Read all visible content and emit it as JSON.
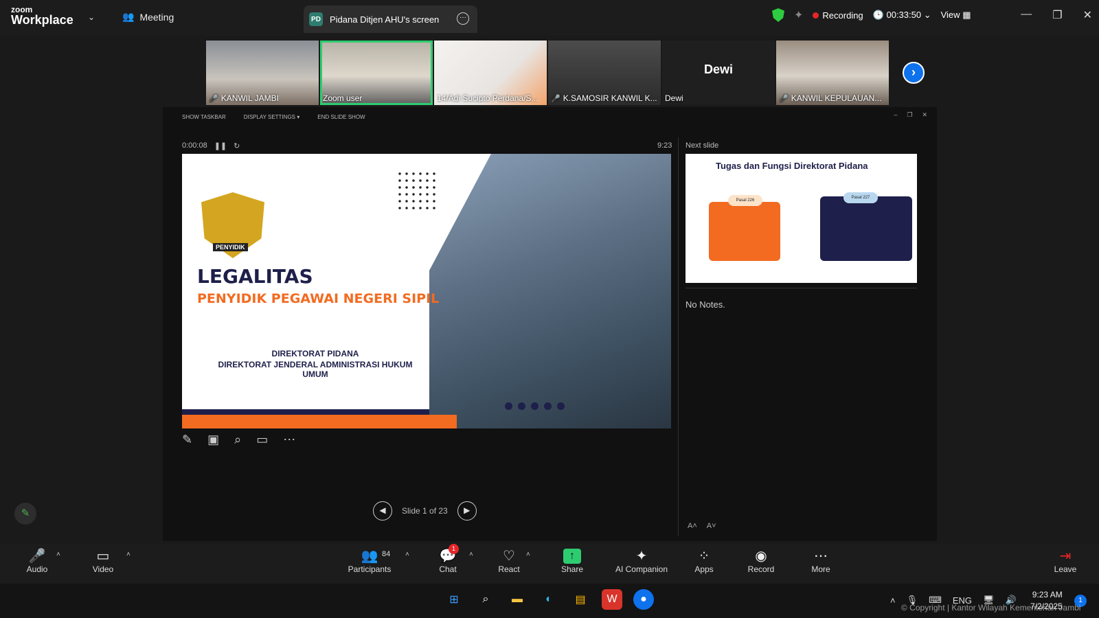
{
  "app": {
    "logo_top": "zoom",
    "logo_bottom": "Workplace",
    "meeting_label": "Meeting"
  },
  "share_tab": {
    "badge": "PD",
    "label": "Pidana Ditjen AHU's screen"
  },
  "status": {
    "recording": "Recording",
    "elapsed": "00:33:50",
    "view": "View"
  },
  "gallery": [
    {
      "name": "KANWIL JAMBI",
      "muted": true
    },
    {
      "name": "Zoom user",
      "muted": false,
      "active": true
    },
    {
      "name": "14/Adi Sucipto Perdana/S...",
      "muted": false
    },
    {
      "name": "K.SAMOSIR KANWIL K...",
      "muted": true
    },
    {
      "name": "Dewi",
      "muted": false,
      "big_label": "Dewi"
    },
    {
      "name": "KANWIL KEPULAUAN...",
      "muted": true
    }
  ],
  "presenter": {
    "show_taskbar": "SHOW TASKBAR",
    "display_settings": "DISPLAY SETTINGS ▾",
    "end_show": "END SLIDE SHOW",
    "timer": "0:00:08",
    "clock": "9:23",
    "next_slide": "Next slide",
    "no_notes": "No Notes.",
    "slide_counter": "Slide 1 of 23"
  },
  "slide": {
    "title1": "LEGALITAS",
    "title2": "PENYIDIK PEGAWAI NEGERI SIPIL",
    "sub1": "DIREKTORAT PIDANA",
    "sub2": "DIREKTORAT JENDERAL ADMINISTRASI HUKUM UMUM",
    "emblem_text": "PENYIDIK"
  },
  "next_thumb": {
    "title": "Tugas dan Fungsi Direktorat Pidana",
    "pasal1": "Pasal 226",
    "pasal2": "Pasal 227"
  },
  "toolbar": {
    "audio": "Audio",
    "video": "Video",
    "participants": "Participants",
    "participant_count": "84",
    "chat": "Chat",
    "chat_badge": "1",
    "react": "React",
    "share": "Share",
    "ai": "AI Companion",
    "apps": "Apps",
    "record": "Record",
    "more": "More",
    "leave": "Leave"
  },
  "taskbar": {
    "lang": "ENG",
    "time": "9:23 AM",
    "date": "7/2/2025",
    "notif": "1"
  },
  "watermark": "© Copyright | Kantor Wilayah Kementerian Jambi"
}
